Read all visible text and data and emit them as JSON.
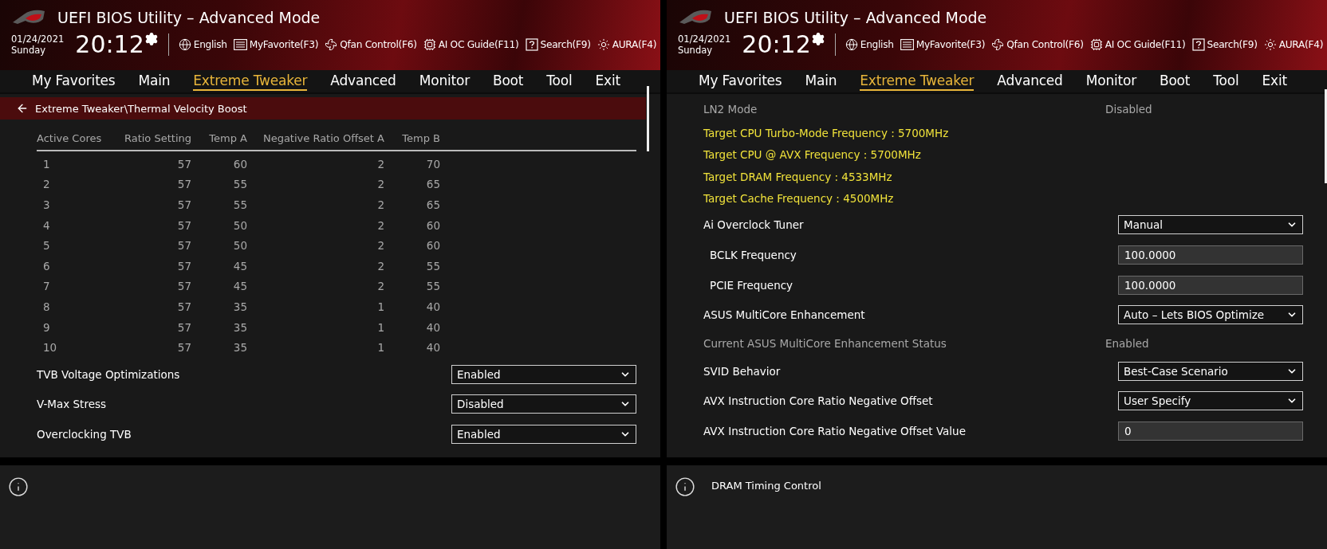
{
  "panels": [
    {
      "header": {
        "title": "UEFI BIOS Utility – Advanced Mode",
        "date": "01/24/2021",
        "day": "Sunday",
        "time": "20:12",
        "toolbar": [
          {
            "kind": "language",
            "label": "English"
          },
          {
            "kind": "favorite",
            "label": "MyFavorite(F3)"
          },
          {
            "kind": "fan",
            "label": "Qfan Control(F6)"
          },
          {
            "kind": "guide",
            "label": "AI OC Guide(F11)"
          },
          {
            "kind": "search",
            "label": "Search(F9)"
          },
          {
            "kind": "aura",
            "label": "AURA(F4)"
          }
        ]
      },
      "tabs": [
        {
          "label": "My Favorites",
          "selected": false
        },
        {
          "label": "Main",
          "selected": false
        },
        {
          "label": "Extreme Tweaker",
          "selected": true
        },
        {
          "label": "Advanced",
          "selected": false
        },
        {
          "label": "Monitor",
          "selected": false
        },
        {
          "label": "Boot",
          "selected": false
        },
        {
          "label": "Tool",
          "selected": false
        },
        {
          "label": "Exit",
          "selected": false
        }
      ],
      "breadcrumb": "Extreme Tweaker\\Thermal Velocity Boost",
      "table": {
        "columns": [
          "Active Cores",
          "Ratio Setting",
          "Temp A",
          "Negative Ratio Offset A",
          "Temp B"
        ],
        "rows": [
          [
            "1",
            "57",
            "60",
            "2",
            "70"
          ],
          [
            "2",
            "57",
            "55",
            "2",
            "65"
          ],
          [
            "3",
            "57",
            "55",
            "2",
            "65"
          ],
          [
            "4",
            "57",
            "50",
            "2",
            "60"
          ],
          [
            "5",
            "57",
            "50",
            "2",
            "60"
          ],
          [
            "6",
            "57",
            "45",
            "2",
            "55"
          ],
          [
            "7",
            "57",
            "45",
            "2",
            "55"
          ],
          [
            "8",
            "57",
            "35",
            "1",
            "40"
          ],
          [
            "9",
            "57",
            "35",
            "1",
            "40"
          ],
          [
            "10",
            "57",
            "35",
            "1",
            "40"
          ]
        ]
      },
      "settings": [
        {
          "kind": "dropdown",
          "label": "TVB Voltage Optimizations",
          "value": "Enabled"
        },
        {
          "kind": "dropdown",
          "label": "V-Max Stress",
          "value": "Disabled"
        },
        {
          "kind": "dropdown",
          "label": "Overclocking TVB",
          "value": "Enabled"
        }
      ]
    },
    {
      "header": {
        "title": "UEFI BIOS Utility – Advanced Mode",
        "date": "01/24/2021",
        "day": "Sunday",
        "time": "20:12",
        "toolbar": [
          {
            "kind": "language",
            "label": "English"
          },
          {
            "kind": "favorite",
            "label": "MyFavorite(F3)"
          },
          {
            "kind": "fan",
            "label": "Qfan Control(F6)"
          },
          {
            "kind": "guide",
            "label": "AI OC Guide(F11)"
          },
          {
            "kind": "search",
            "label": "Search(F9)"
          },
          {
            "kind": "aura",
            "label": "AURA(F4)"
          }
        ]
      },
      "tabs": [
        {
          "label": "My Favorites",
          "selected": false
        },
        {
          "label": "Main",
          "selected": false
        },
        {
          "label": "Extreme Tweaker",
          "selected": true
        },
        {
          "label": "Advanced",
          "selected": false
        },
        {
          "label": "Monitor",
          "selected": false
        },
        {
          "label": "Boot",
          "selected": false
        },
        {
          "label": "Tool",
          "selected": false
        },
        {
          "label": "Exit",
          "selected": false
        }
      ],
      "settings": [
        {
          "kind": "info",
          "label": "LN2 Mode",
          "value": "Disabled"
        },
        {
          "kind": "highlight",
          "label": "Target CPU Turbo-Mode Frequency : 5700MHz"
        },
        {
          "kind": "highlight",
          "label": "Target CPU @ AVX Frequency : 5700MHz"
        },
        {
          "kind": "highlight",
          "label": "Target DRAM Frequency : 4533MHz"
        },
        {
          "kind": "highlight",
          "label": "Target Cache Frequency : 4500MHz"
        },
        {
          "kind": "dropdown",
          "label": "Ai Overclock Tuner",
          "value": "Manual",
          "children": [
            {
              "kind": "field",
              "label": "BCLK Frequency",
              "value": "100.0000"
            },
            {
              "kind": "field",
              "label": "PCIE Frequency",
              "value": "100.0000"
            }
          ]
        },
        {
          "kind": "dropdown",
          "label": "ASUS MultiCore Enhancement",
          "value": "Auto – Lets BIOS Optimize"
        },
        {
          "kind": "info",
          "label": "Current ASUS MultiCore Enhancement Status",
          "value": "Enabled"
        },
        {
          "kind": "dropdown",
          "label": "SVID Behavior",
          "value": "Best-Case Scenario"
        },
        {
          "kind": "dropdown",
          "label": "AVX Instruction Core Ratio Negative Offset",
          "value": "User Specify"
        },
        {
          "kind": "field",
          "label": "AVX Instruction Core Ratio Negative Offset Value",
          "value": "0"
        }
      ],
      "help": {
        "text": "DRAM Timing Control"
      }
    }
  ]
}
